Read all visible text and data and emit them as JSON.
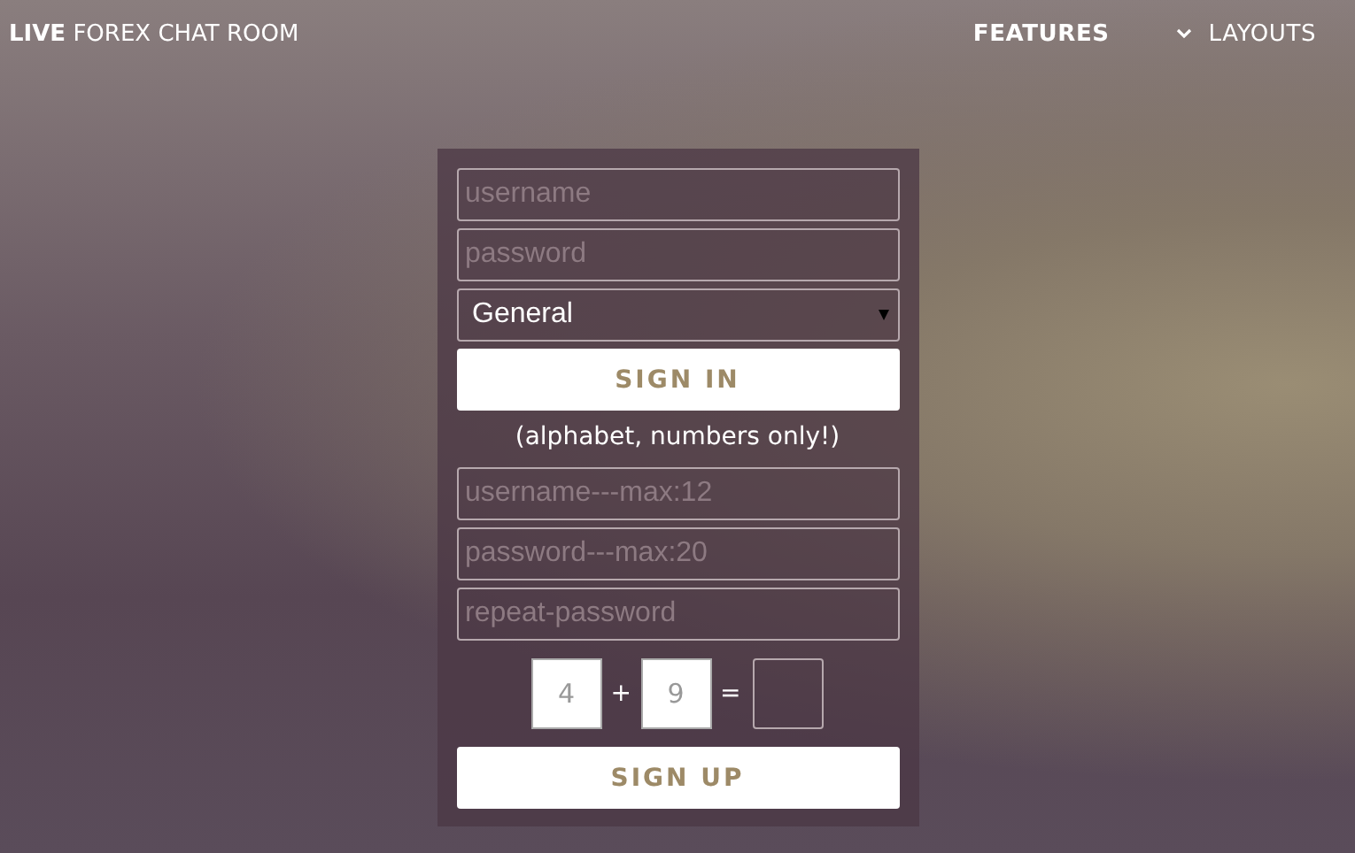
{
  "brand": "**LIVE** FOREX CHAT ROOM",
  "nav": [
    {
      "label": "FEATURES",
      "selected": true,
      "dropdown": false
    },
    {
      "label": "LAYOUTS",
      "selected": false,
      "dropdown": true
    }
  ],
  "login": {
    "fields": [
      {
        "placeholder": "username"
      },
      {
        "placeholder": "password"
      }
    ],
    "room_select": {
      "value": "General"
    },
    "button": "SIGN IN"
  },
  "hint": "(alphabet, numbers only!)",
  "register": {
    "fields": [
      {
        "placeholder": "username---max:12"
      },
      {
        "placeholder": "password---max:20"
      },
      {
        "placeholder": "repeat-password"
      }
    ],
    "captcha": {
      "a": "4",
      "op": "+",
      "b": "9",
      "eq": "="
    },
    "button": "SIGN UP"
  }
}
